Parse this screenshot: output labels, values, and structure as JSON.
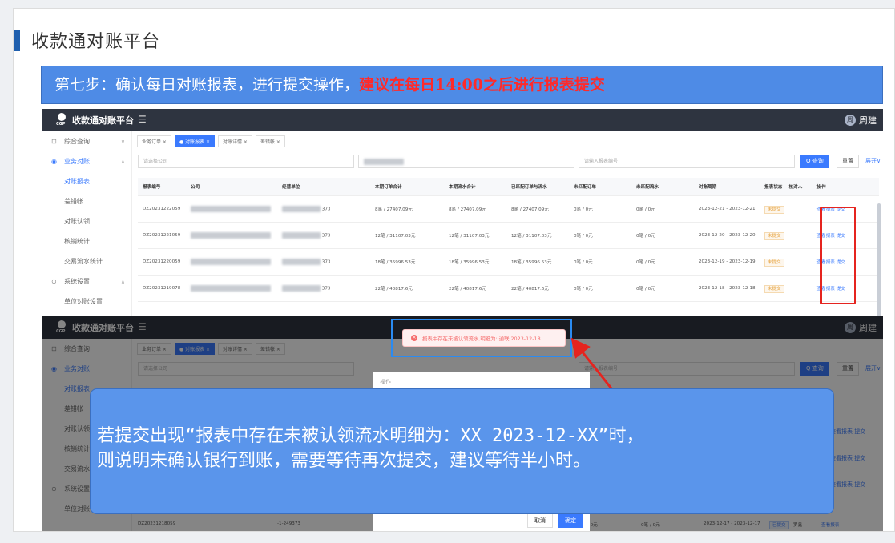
{
  "page": {
    "title": "收款通对账平台"
  },
  "banner": {
    "step": "第七步：确认每日对账报表，进行提交操作，",
    "warning": "建议在每日14:00之后进行报表提交"
  },
  "app": {
    "brand": "收款通对账平台",
    "logo_text": "CGP",
    "user": "周建",
    "user_initial": "周",
    "menu_icon": "menu-fold-icon",
    "sidebar": [
      {
        "label": "综合查询",
        "icon": "search-icon",
        "type": "group"
      },
      {
        "label": "业务对账",
        "icon": "reconcile-icon",
        "type": "group",
        "active": true
      },
      {
        "label": "对账报表",
        "type": "sub",
        "active": true
      },
      {
        "label": "差错帐",
        "type": "sub"
      },
      {
        "label": "对账认领",
        "type": "sub"
      },
      {
        "label": "核销统计",
        "type": "sub"
      },
      {
        "label": "交易流水统计",
        "type": "sub"
      },
      {
        "label": "系统设置",
        "icon": "settings-icon",
        "type": "group"
      },
      {
        "label": "单位对账设置",
        "type": "sub"
      }
    ],
    "tabs": [
      "业务订单 ×",
      "● 对账报表 ×",
      "对账详情 ×",
      "差错帐 ×"
    ],
    "filters": {
      "company_placeholder": "请选择公司",
      "report_placeholder": "请输入报表编号",
      "query": "Q 查询",
      "reset": "重置",
      "expand": "展开∨"
    },
    "columns": [
      "报表编号",
      "公司",
      "经营单位",
      "本期订单合计",
      "本期流水合计",
      "已匹配订单与流水",
      "未匹配订单",
      "未匹配流水",
      "对账周期",
      "报表状态",
      "核对人",
      "操作"
    ],
    "rows": [
      {
        "id": "DZ20231222059",
        "unit": "373",
        "orders": "8笔 / 27407.09元",
        "flows": "8笔 / 27407.09元",
        "matched": "8笔 / 27407.09元",
        "uo": "0笔 / 0元",
        "uf": "0笔 / 0元",
        "period": "2023-12-21 - 2023-12-21",
        "status": "未提交",
        "checker": "",
        "view": "查看报表",
        "submit": "提交"
      },
      {
        "id": "DZ20231221059",
        "unit": "373",
        "orders": "12笔 / 31107.03元",
        "flows": "12笔 / 31107.03元",
        "matched": "12笔 / 31107.03元",
        "uo": "0笔 / 0元",
        "uf": "0笔 / 0元",
        "period": "2023-12-20 - 2023-12-20",
        "status": "未提交",
        "checker": "",
        "view": "查看报表",
        "submit": "提交"
      },
      {
        "id": "DZ20231220059",
        "unit": "373",
        "orders": "18笔 / 35996.53元",
        "flows": "18笔 / 35996.53元",
        "matched": "18笔 / 35996.53元",
        "uo": "0笔 / 0元",
        "uf": "0笔 / 0元",
        "period": "2023-12-19 - 2023-12-19",
        "status": "未提交",
        "checker": "",
        "view": "查看报表",
        "submit": "提交"
      },
      {
        "id": "DZ20231219078",
        "unit": "373",
        "orders": "22笔 / 40817.6元",
        "flows": "22笔 / 40817.6元",
        "matched": "22笔 / 40817.6元",
        "uo": "0笔 / 0元",
        "uf": "0笔 / 0元",
        "period": "2023-12-18 - 2023-12-18",
        "status": "未提交",
        "checker": "",
        "view": "查看报表",
        "submit": "提交"
      }
    ],
    "row2_last": {
      "id": "DZ20231218059",
      "unit": "-1-249373",
      "uf": "0笔 / 0元",
      "uo": "0笔 / 0元",
      "period": "2023-12-17 - 2023-12-17",
      "status": "已提交",
      "checker": "罗鑫",
      "view": "查看报表"
    },
    "side_ops": [
      "查看报表 提交",
      "查看报表 提交",
      "查看报表 提交",
      "查看报表 提交"
    ]
  },
  "toast": {
    "text": "报表中存在未被认领流水,明细为: 通联 2023-12-18",
    "icon": "error-circle-icon"
  },
  "dialog": {
    "cancel": "取消",
    "confirm": "确定",
    "header_fragment": "操作"
  },
  "note": {
    "line1": "若提交出现“报表中存在未被认领流水明细为：XX 2023-12-XX”时，",
    "line2": "则说明未确认银行到账，需要等待再次提交，建议等待半小时。"
  },
  "colors": {
    "accent": "#3a7afe",
    "banner": "#4e8be6",
    "highlight_red": "#e5241f",
    "toast_frame": "#2a8bf2"
  }
}
